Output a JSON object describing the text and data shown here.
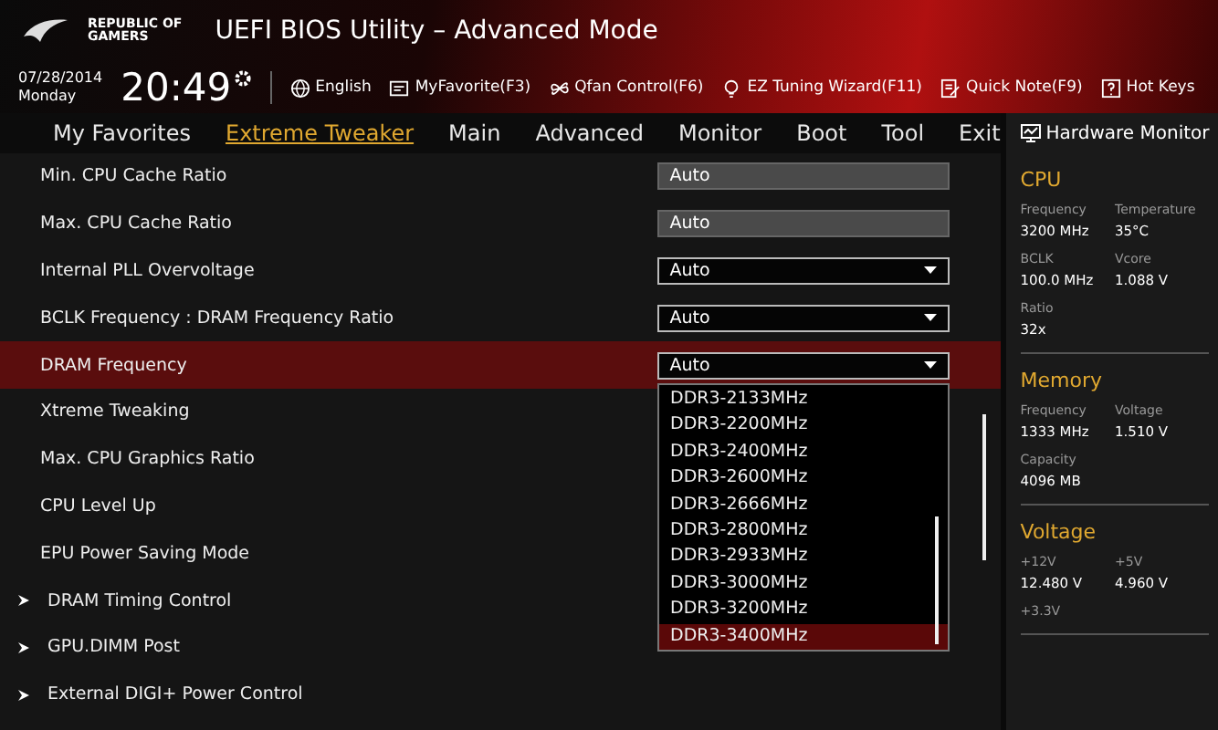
{
  "header": {
    "brand_line1": "REPUBLIC OF",
    "brand_line2": "GAMERS",
    "title": "UEFI BIOS Utility – Advanced Mode"
  },
  "info_bar": {
    "date": "07/28/2014",
    "day": "Monday",
    "time": "20:49",
    "tools": [
      {
        "kind": "globe",
        "label": "English"
      },
      {
        "kind": "favorite",
        "label": "MyFavorite(F3)"
      },
      {
        "kind": "fan",
        "label": "Qfan Control(F6)"
      },
      {
        "kind": "bulb",
        "label": "EZ Tuning Wizard(F11)"
      },
      {
        "kind": "note",
        "label": "Quick Note(F9)"
      },
      {
        "kind": "help",
        "label": "Hot Keys"
      }
    ]
  },
  "tabs": [
    {
      "label": "My Favorites",
      "selected": false
    },
    {
      "label": "Extreme Tweaker",
      "selected": true
    },
    {
      "label": "Main",
      "selected": false
    },
    {
      "label": "Advanced",
      "selected": false
    },
    {
      "label": "Monitor",
      "selected": false
    },
    {
      "label": "Boot",
      "selected": false
    },
    {
      "label": "Tool",
      "selected": false
    },
    {
      "label": "Exit",
      "selected": false
    }
  ],
  "settings": [
    {
      "kind": "field",
      "label": "Min. CPU Cache Ratio",
      "value": "Auto",
      "selected": false
    },
    {
      "kind": "field",
      "label": "Max. CPU Cache Ratio",
      "value": "Auto",
      "selected": false
    },
    {
      "kind": "dropdown",
      "label": "Internal PLL Overvoltage",
      "value": "Auto",
      "selected": false
    },
    {
      "kind": "dropdown",
      "label": "BCLK Frequency : DRAM Frequency Ratio",
      "value": "Auto",
      "selected": false
    },
    {
      "kind": "dropdown",
      "label": "DRAM Frequency",
      "value": "Auto",
      "selected": true
    },
    {
      "kind": "plain",
      "label": "Xtreme Tweaking",
      "selected": false
    },
    {
      "kind": "plain",
      "label": "Max. CPU Graphics Ratio",
      "selected": false
    },
    {
      "kind": "plain",
      "label": "CPU Level Up",
      "selected": false
    },
    {
      "kind": "plain",
      "label": "EPU Power Saving Mode",
      "selected": false
    },
    {
      "kind": "submenu",
      "label": "DRAM Timing Control",
      "selected": false
    },
    {
      "kind": "submenu",
      "label": "GPU.DIMM Post",
      "selected": false
    },
    {
      "kind": "submenu",
      "label": "External DIGI+ Power Control",
      "selected": false
    }
  ],
  "dropdown_options": [
    {
      "label": "DDR3-2133MHz",
      "selected": false
    },
    {
      "label": "DDR3-2200MHz",
      "selected": false
    },
    {
      "label": "DDR3-2400MHz",
      "selected": false
    },
    {
      "label": "DDR3-2600MHz",
      "selected": false
    },
    {
      "label": "DDR3-2666MHz",
      "selected": false
    },
    {
      "label": "DDR3-2800MHz",
      "selected": false
    },
    {
      "label": "DDR3-2933MHz",
      "selected": false
    },
    {
      "label": "DDR3-3000MHz",
      "selected": false
    },
    {
      "label": "DDR3-3200MHz",
      "selected": false
    },
    {
      "label": "DDR3-3400MHz",
      "selected": true
    }
  ],
  "hardware_monitor": {
    "title": "Hardware Monitor",
    "sections": [
      {
        "title": "CPU",
        "readings": [
          {
            "label": "Frequency",
            "value": "3200 MHz"
          },
          {
            "label": "Temperature",
            "value": "35°C"
          },
          {
            "label": "BCLK",
            "value": "100.0 MHz"
          },
          {
            "label": "Vcore",
            "value": "1.088 V"
          },
          {
            "label": "Ratio",
            "value": "32x"
          }
        ]
      },
      {
        "title": "Memory",
        "readings": [
          {
            "label": "Frequency",
            "value": "1333 MHz"
          },
          {
            "label": "Voltage",
            "value": "1.510 V"
          },
          {
            "label": "Capacity",
            "value": "4096 MB"
          }
        ]
      },
      {
        "title": "Voltage",
        "readings": [
          {
            "label": "+12V",
            "value": "12.480 V"
          },
          {
            "label": "+5V",
            "value": "4.960 V"
          },
          {
            "label": "+3.3V"
          }
        ]
      }
    ]
  }
}
